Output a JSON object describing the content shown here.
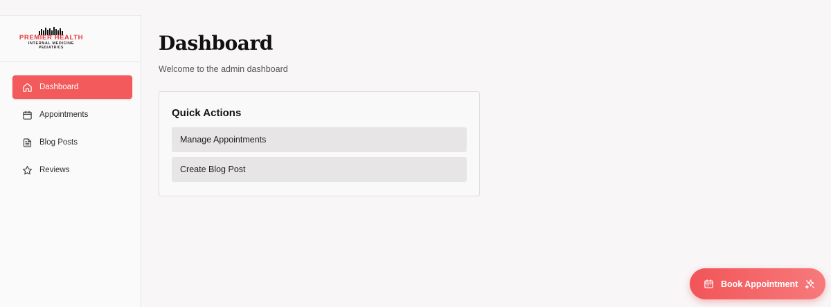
{
  "logo": {
    "brand": "PREMIER HEALTH",
    "line1": "INTERNAL MEDICINE",
    "line2": "PEDIATRICS",
    "brand_color": "#e8383d"
  },
  "sidebar": {
    "items": [
      {
        "label": "Dashboard",
        "icon": "home-icon",
        "active": true
      },
      {
        "label": "Appointments",
        "icon": "calendar-icon",
        "active": false
      },
      {
        "label": "Blog Posts",
        "icon": "document-icon",
        "active": false
      },
      {
        "label": "Reviews",
        "icon": "star-icon",
        "active": false
      }
    ]
  },
  "main": {
    "title": "Dashboard",
    "subtitle": "Welcome to the admin dashboard"
  },
  "quick_actions": {
    "title": "Quick Actions",
    "actions": [
      "Manage Appointments",
      "Create Blog Post"
    ]
  },
  "book_button": {
    "label": "Book Appointment",
    "icon": "calendar-icon",
    "trailing_icon": "sparkle-icon"
  },
  "colors": {
    "accent": "#f35a5c",
    "background": "#f8f6f7",
    "action_button_bg": "#e8e5e6"
  }
}
